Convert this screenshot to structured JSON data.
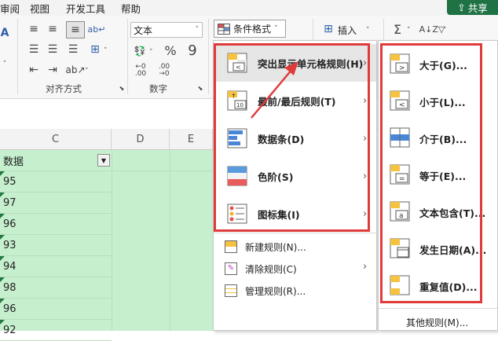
{
  "menubar": {
    "tabs": [
      "审阅",
      "视图",
      "开发工具",
      "帮助"
    ],
    "share_label": "共享"
  },
  "ribbon": {
    "alignment_group_label": "对齐方式",
    "number_group_label": "数字",
    "number_format_value": "文本",
    "cond_format_label": "条件格式",
    "insert_label": "插入"
  },
  "sheet": {
    "column_headers": [
      "C",
      "D",
      "E"
    ],
    "header_cell": "数据",
    "values": [
      "95",
      "97",
      "96",
      "93",
      "94",
      "98",
      "96",
      "92"
    ]
  },
  "cf_menu": {
    "items": [
      {
        "label": "突出显示单元格规则(H)",
        "has_submenu": true
      },
      {
        "label": "最前/最后规则(T)",
        "has_submenu": true
      },
      {
        "label": "数据条(D)",
        "has_submenu": true
      },
      {
        "label": "色阶(S)",
        "has_submenu": true
      },
      {
        "label": "图标集(I)",
        "has_submenu": true
      }
    ],
    "small_items": [
      {
        "label": "新建规则(N)...",
        "has_submenu": false
      },
      {
        "label": "清除规则(C)",
        "has_submenu": true
      },
      {
        "label": "管理规则(R)...",
        "has_submenu": false
      }
    ]
  },
  "highlight_submenu": {
    "items": [
      "大于(G)...",
      "小于(L)...",
      "介于(B)...",
      "等于(E)...",
      "文本包含(T)...",
      "发生日期(A)...",
      "重复值(D)..."
    ],
    "more_rules": "其他规则(M)..."
  },
  "colors": {
    "accent_green": "#1f7244",
    "highlight_red": "#e03b3b",
    "cell_fill": "#c6efce"
  }
}
